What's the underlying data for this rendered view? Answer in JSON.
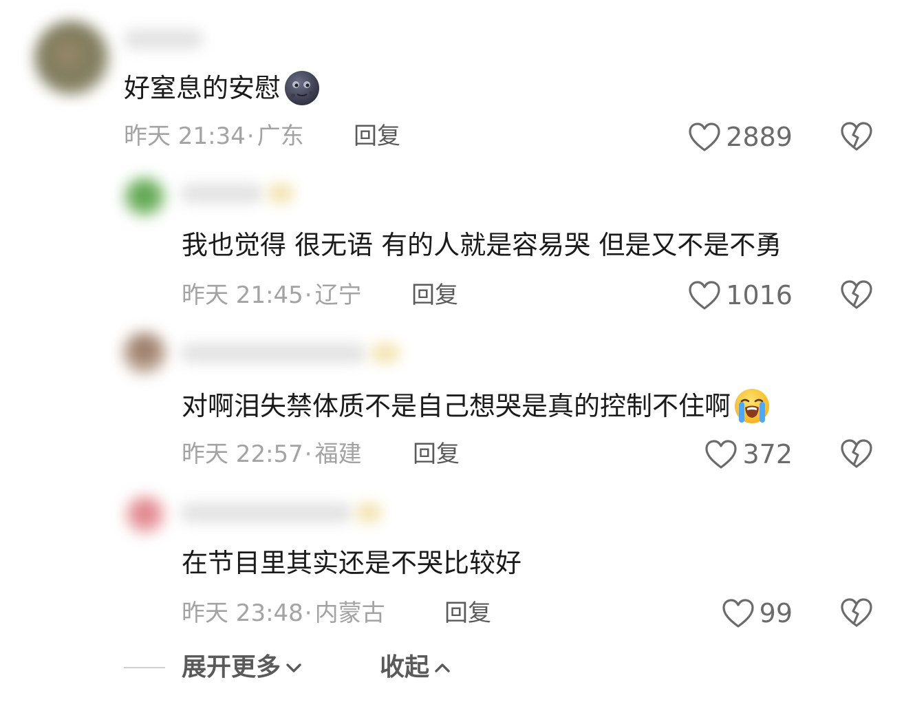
{
  "comments": [
    {
      "text": "好窒息的安慰",
      "emoji": "new-moon-face-emoji",
      "time": "昨天 21:34",
      "location": "广东",
      "reply": "回复",
      "likes": "2889"
    },
    {
      "text": "我也觉得 很无语 有的人就是容易哭 但是又不是不勇",
      "time": "昨天 21:45",
      "location": "辽宁",
      "reply": "回复",
      "likes": "1016"
    },
    {
      "text": "对啊泪失禁体质不是自己想哭是真的控制不住啊",
      "emoji": "loudly-crying-face-emoji",
      "time": "昨天 22:57",
      "location": "福建",
      "reply": "回复",
      "likes": "372"
    },
    {
      "text": "在节目里其实还是不哭比较好",
      "time": "昨天 23:48",
      "location": "内蒙古",
      "reply": "回复",
      "likes": "99"
    }
  ],
  "footer": {
    "expand_more": "展开更多",
    "collapse": "收起"
  },
  "colors": {
    "text": "#1a1a1a",
    "meta": "#a3a3a3",
    "reply": "#5a5a5a",
    "icon": "#6b6b6b"
  },
  "separator": "·"
}
